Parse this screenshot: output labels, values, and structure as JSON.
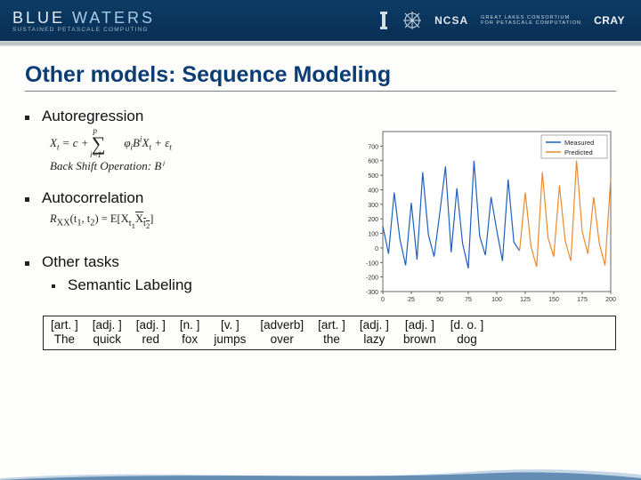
{
  "header": {
    "logo_main_1": "BLUE",
    "logo_main_2": "WATERS",
    "logo_sub": "SUSTAINED PETASCALE COMPUTING",
    "ncsa": "NCSA",
    "glc1": "GREAT LAKES CONSORTIUM",
    "glc2": "FOR PETASCALE COMPUTATION",
    "cray": "CRAY"
  },
  "title": "Other models: Sequence Modeling",
  "bullets": {
    "b1": "Autoregression",
    "b2": "Autocorrelation",
    "b3": "Other tasks",
    "b3a": "Semantic Labeling"
  },
  "formula1_label": "Back Shift Operation: ",
  "formula1_b": "Bⁱ",
  "semantic": {
    "tags": [
      "[art. ]",
      "[adj. ]",
      "[adj. ]",
      "[n. ]",
      "[v. ]",
      "[adverb]",
      "[art. ]",
      "[adj. ]",
      "[adj. ]",
      "[d. o. ]"
    ],
    "words": [
      "The",
      "quick",
      "red",
      "fox",
      "jumps",
      "over",
      "the",
      "lazy",
      "brown",
      "dog"
    ]
  },
  "chart_data": {
    "type": "line",
    "title": "",
    "xlabel": "",
    "ylabel": "",
    "xlim": [
      0,
      200
    ],
    "ylim": [
      -300,
      800
    ],
    "yticks": [
      -300,
      -200,
      -100,
      0,
      100,
      200,
      300,
      400,
      500,
      600,
      700
    ],
    "xticks": [
      0,
      25,
      50,
      75,
      100,
      125,
      150,
      175,
      200
    ],
    "legend": {
      "position": "upper right"
    },
    "series": [
      {
        "name": "Measured",
        "color": "#1f5fbf",
        "x": [
          0,
          5,
          10,
          15,
          20,
          25,
          30,
          35,
          40,
          45,
          50,
          55,
          60,
          65,
          70,
          75,
          80,
          85,
          90,
          95,
          100,
          105,
          110,
          115,
          120
        ],
        "y": [
          150,
          -40,
          380,
          60,
          -120,
          310,
          -80,
          520,
          90,
          -60,
          240,
          560,
          -30,
          410,
          30,
          -140,
          600,
          80,
          -50,
          350,
          120,
          -90,
          470,
          40,
          -20
        ]
      },
      {
        "name": "Predicted",
        "color": "#e98a2e",
        "x": [
          120,
          125,
          130,
          135,
          140,
          145,
          150,
          155,
          160,
          165,
          170,
          175,
          180,
          185,
          190,
          195,
          200
        ],
        "y": [
          -20,
          380,
          10,
          -130,
          520,
          70,
          -60,
          430,
          50,
          -90,
          600,
          110,
          -40,
          350,
          30,
          -120,
          480
        ]
      }
    ]
  }
}
